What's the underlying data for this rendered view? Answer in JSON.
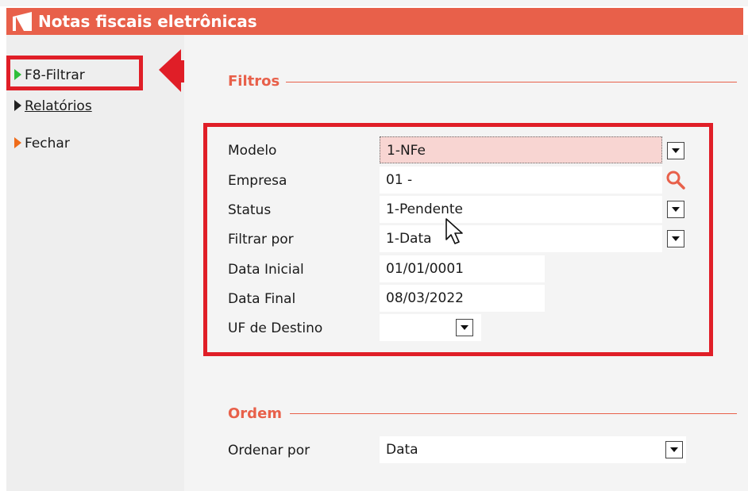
{
  "window": {
    "title": "Notas fiscais eletrônicas"
  },
  "menu": {
    "items": [
      {
        "label": "F8-Filtrar",
        "icon": "play-green-icon"
      },
      {
        "label": "Relatórios",
        "icon": "play-black-icon"
      },
      {
        "label": "Fechar",
        "icon": "play-orange-icon"
      }
    ]
  },
  "filtros": {
    "title": "Filtros",
    "fields": [
      {
        "label": "Modelo",
        "value": "1-NFe"
      },
      {
        "label": "Empresa",
        "value": "01 -"
      },
      {
        "label": "Status",
        "value": "1-Pendente"
      },
      {
        "label": "Filtrar por",
        "value": "1-Data"
      },
      {
        "label": "Data Inicial",
        "value": "01/01/0001"
      },
      {
        "label": "Data Final",
        "value": "08/03/2022"
      },
      {
        "label": "UF de Destino",
        "value": ""
      }
    ]
  },
  "ordem": {
    "title": "Ordem",
    "label": "Ordenar por",
    "value": "Data"
  },
  "colors": {
    "accent": "#e8604a",
    "highlight": "#e01e27",
    "selected_field": "#f8d5d2"
  }
}
